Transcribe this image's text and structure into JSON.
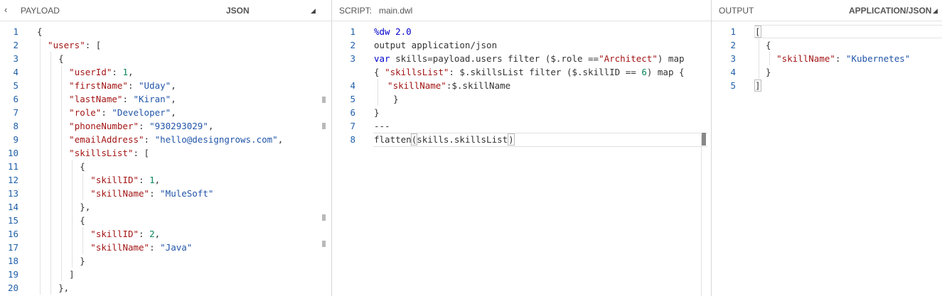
{
  "payload": {
    "back_icon": "‹",
    "title": "PAYLOAD",
    "format": "JSON",
    "dropdown_icon": "◢",
    "lines": [
      [
        {
          "t": "{",
          "c": "p"
        }
      ],
      [
        {
          "t": "\"users\"",
          "c": "k"
        },
        {
          "t": ": [",
          "c": "p"
        }
      ],
      [
        {
          "t": "{",
          "c": "p"
        }
      ],
      [
        {
          "t": "\"userId\"",
          "c": "k"
        },
        {
          "t": ": ",
          "c": "p"
        },
        {
          "t": "1",
          "c": "n"
        },
        {
          "t": ",",
          "c": "p"
        }
      ],
      [
        {
          "t": "\"firstName\"",
          "c": "k"
        },
        {
          "t": ": ",
          "c": "p"
        },
        {
          "t": "\"Uday\"",
          "c": "s"
        },
        {
          "t": ",",
          "c": "p"
        }
      ],
      [
        {
          "t": "\"lastName\"",
          "c": "k"
        },
        {
          "t": ": ",
          "c": "p"
        },
        {
          "t": "\"Kiran\"",
          "c": "s"
        },
        {
          "t": ",",
          "c": "p"
        }
      ],
      [
        {
          "t": "\"role\"",
          "c": "k"
        },
        {
          "t": ": ",
          "c": "p"
        },
        {
          "t": "\"Developer\"",
          "c": "s"
        },
        {
          "t": ",",
          "c": "p"
        }
      ],
      [
        {
          "t": "\"phoneNumber\"",
          "c": "k"
        },
        {
          "t": ": ",
          "c": "p"
        },
        {
          "t": "\"930293029\"",
          "c": "s"
        },
        {
          "t": ",",
          "c": "p"
        }
      ],
      [
        {
          "t": "\"emailAddress\"",
          "c": "k"
        },
        {
          "t": ": ",
          "c": "p"
        },
        {
          "t": "\"hello@designgrows.com\"",
          "c": "s"
        },
        {
          "t": ",",
          "c": "p"
        }
      ],
      [
        {
          "t": "\"skillsList\"",
          "c": "k"
        },
        {
          "t": ": [",
          "c": "p"
        }
      ],
      [
        {
          "t": "{",
          "c": "p"
        }
      ],
      [
        {
          "t": "\"skillID\"",
          "c": "k"
        },
        {
          "t": ": ",
          "c": "p"
        },
        {
          "t": "1",
          "c": "n"
        },
        {
          "t": ",",
          "c": "p"
        }
      ],
      [
        {
          "t": "\"skillName\"",
          "c": "k"
        },
        {
          "t": ": ",
          "c": "p"
        },
        {
          "t": "\"MuleSoft\"",
          "c": "s"
        }
      ],
      [
        {
          "t": "},",
          "c": "p"
        }
      ],
      [
        {
          "t": "{",
          "c": "p"
        }
      ],
      [
        {
          "t": "\"skillID\"",
          "c": "k"
        },
        {
          "t": ": ",
          "c": "p"
        },
        {
          "t": "2",
          "c": "n"
        },
        {
          "t": ",",
          "c": "p"
        }
      ],
      [
        {
          "t": "\"skillName\"",
          "c": "k"
        },
        {
          "t": ": ",
          "c": "p"
        },
        {
          "t": "\"Java\"",
          "c": "s"
        }
      ],
      [
        {
          "t": "}",
          "c": "p"
        }
      ],
      [
        {
          "t": "]",
          "c": "p"
        }
      ],
      [
        {
          "t": "},",
          "c": "p"
        }
      ]
    ]
  },
  "script": {
    "label": "SCRIPT:",
    "filename": "main.dwl",
    "lines": [
      {
        "num": "1",
        "segs": [
          {
            "t": "%dw 2.0",
            "c": "dw"
          }
        ]
      },
      {
        "num": "2",
        "segs": [
          {
            "t": "output application/json",
            "c": "p"
          }
        ]
      },
      {
        "num": "3",
        "segs": [
          {
            "t": "var",
            "c": "kw"
          },
          {
            "t": " skills=payload.users filter ($.role ==",
            "c": "p"
          },
          {
            "t": "\"Architect\"",
            "c": "k"
          },
          {
            "t": ") map",
            "c": "p"
          }
        ]
      },
      {
        "num": "",
        "segs": [
          {
            "t": "{ ",
            "c": "p"
          },
          {
            "t": "\"skillsList\"",
            "c": "k"
          },
          {
            "t": ": $.skillsList filter ($.skillID == ",
            "c": "p"
          },
          {
            "t": "6",
            "c": "n"
          },
          {
            "t": ") map {",
            "c": "p"
          }
        ]
      },
      {
        "num": "4",
        "segs": [
          {
            "t": "\"skillName\"",
            "c": "k"
          },
          {
            "t": ":$.skillName",
            "c": "p"
          }
        ]
      },
      {
        "num": "5",
        "segs": [
          {
            "t": "}",
            "c": "p"
          }
        ]
      },
      {
        "num": "6",
        "segs": [
          {
            "t": "}",
            "c": "p"
          }
        ]
      },
      {
        "num": "7",
        "segs": [
          {
            "t": "---",
            "c": "p"
          }
        ]
      },
      {
        "num": "8",
        "segs": [
          {
            "t": "flatten",
            "c": "p"
          },
          {
            "t": "(",
            "c": "bm"
          },
          {
            "t": "skills.skillsList",
            "c": "p"
          },
          {
            "t": "|",
            "c": "cur"
          },
          {
            "t": ")",
            "c": "bm"
          }
        ]
      }
    ]
  },
  "output": {
    "title": "OUTPUT",
    "format": "APPLICATION/JSON",
    "dropdown_icon": "◢",
    "lines": [
      [
        {
          "t": "[",
          "c": "bm"
        }
      ],
      [
        {
          "t": "{",
          "c": "p"
        }
      ],
      [
        {
          "t": "\"skillName\"",
          "c": "k"
        },
        {
          "t": ": ",
          "c": "p"
        },
        {
          "t": "\"Kubernetes\"",
          "c": "s"
        }
      ],
      [
        {
          "t": "}",
          "c": "p"
        }
      ],
      [
        {
          "t": "]",
          "c": "bm"
        }
      ]
    ]
  },
  "colors": {
    "key": "#a31515",
    "string": "#2155a8",
    "number": "#098658",
    "keyword": "#0000cc",
    "line_number": "#1e5fa8"
  }
}
